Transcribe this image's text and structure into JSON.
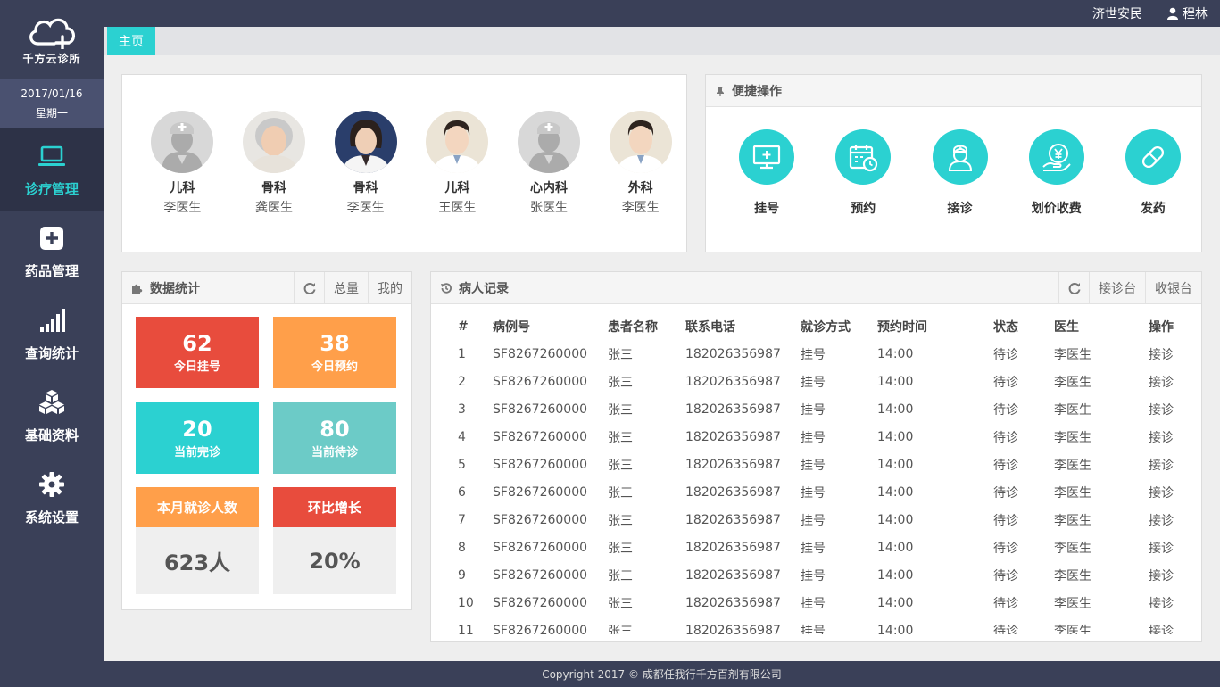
{
  "sidebar": {
    "logo_text": "千方云诊所",
    "date": "2017/01/16",
    "weekday": "星期一",
    "items": [
      {
        "label": "诊疗管理",
        "icon": "laptop-icon"
      },
      {
        "label": "药品管理",
        "icon": "medicine-plus-icon"
      },
      {
        "label": "查询统计",
        "icon": "signal-bars-icon"
      },
      {
        "label": "基础资料",
        "icon": "cubes-icon"
      },
      {
        "label": "系统设置",
        "icon": "gear-icon"
      }
    ]
  },
  "topbar": {
    "org": "济世安民",
    "user": "程林"
  },
  "tabs": {
    "home": "主页"
  },
  "doctors": [
    {
      "dept": "儿科",
      "name": "李医生",
      "avatar": "placeholder"
    },
    {
      "dept": "骨科",
      "name": "龚医生",
      "avatar": "elder-woman"
    },
    {
      "dept": "骨科",
      "name": "李医生",
      "avatar": "woman"
    },
    {
      "dept": "儿科",
      "name": "王医生",
      "avatar": "man"
    },
    {
      "dept": "心内科",
      "name": "张医生",
      "avatar": "placeholder"
    },
    {
      "dept": "外科",
      "name": "李医生",
      "avatar": "man"
    }
  ],
  "quick": {
    "title": "便捷操作",
    "actions": [
      {
        "label": "挂号",
        "icon": "monitor-plus-icon"
      },
      {
        "label": "预约",
        "icon": "calendar-clock-icon"
      },
      {
        "label": "接诊",
        "icon": "doctor-icon"
      },
      {
        "label": "划价收费",
        "icon": "yen-hand-icon"
      },
      {
        "label": "发药",
        "icon": "pill-icon"
      }
    ]
  },
  "stats": {
    "title": "数据统计",
    "actions": [
      "总量",
      "我的"
    ],
    "cards": [
      {
        "num": "62",
        "label": "今日挂号",
        "color": "#e84c3d"
      },
      {
        "num": "38",
        "label": "今日预约",
        "color": "#ff9f4a"
      },
      {
        "num": "20",
        "label": "当前完诊",
        "color": "#2bd1d1"
      },
      {
        "num": "80",
        "label": "当前待诊",
        "color": "#6ccbc7"
      }
    ],
    "monthly_label": "本月就诊人数",
    "monthly_value": "623人",
    "growth_label": "环比增长",
    "growth_value": "20%",
    "monthly_color": "#ff9f4a",
    "growth_color": "#e84c3d"
  },
  "records": {
    "title": "病人记录",
    "actions": [
      "接诊台",
      "收银台"
    ],
    "columns": [
      "#",
      "病例号",
      "患者名称",
      "联系电话",
      "就诊方式",
      "预约时间",
      "状态",
      "医生",
      "操作"
    ],
    "rows": [
      [
        "1",
        "SF8267260000",
        "张三",
        "182026356987",
        "挂号",
        "14:00",
        "待诊",
        "李医生",
        "接诊"
      ],
      [
        "2",
        "SF8267260000",
        "张三",
        "182026356987",
        "挂号",
        "14:00",
        "待诊",
        "李医生",
        "接诊"
      ],
      [
        "3",
        "SF8267260000",
        "张三",
        "182026356987",
        "挂号",
        "14:00",
        "待诊",
        "李医生",
        "接诊"
      ],
      [
        "4",
        "SF8267260000",
        "张三",
        "182026356987",
        "挂号",
        "14:00",
        "待诊",
        "李医生",
        "接诊"
      ],
      [
        "5",
        "SF8267260000",
        "张三",
        "182026356987",
        "挂号",
        "14:00",
        "待诊",
        "李医生",
        "接诊"
      ],
      [
        "6",
        "SF8267260000",
        "张三",
        "182026356987",
        "挂号",
        "14:00",
        "待诊",
        "李医生",
        "接诊"
      ],
      [
        "7",
        "SF8267260000",
        "张三",
        "182026356987",
        "挂号",
        "14:00",
        "待诊",
        "李医生",
        "接诊"
      ],
      [
        "8",
        "SF8267260000",
        "张三",
        "182026356987",
        "挂号",
        "14:00",
        "待诊",
        "李医生",
        "接诊"
      ],
      [
        "9",
        "SF8267260000",
        "张三",
        "182026356987",
        "挂号",
        "14:00",
        "待诊",
        "李医生",
        "接诊"
      ],
      [
        "10",
        "SF8267260000",
        "张三",
        "182026356987",
        "挂号",
        "14:00",
        "待诊",
        "李医生",
        "接诊"
      ],
      [
        "11",
        "SF8267260000",
        "张三",
        "182026356987",
        "挂号",
        "14:00",
        "待诊",
        "李医生",
        "接诊"
      ]
    ]
  },
  "footer": "Copyright 2017 © 成都任我行千方百剂有限公司",
  "colors": {
    "sidebar": "#3a4058",
    "accent": "#2bd1d1"
  }
}
